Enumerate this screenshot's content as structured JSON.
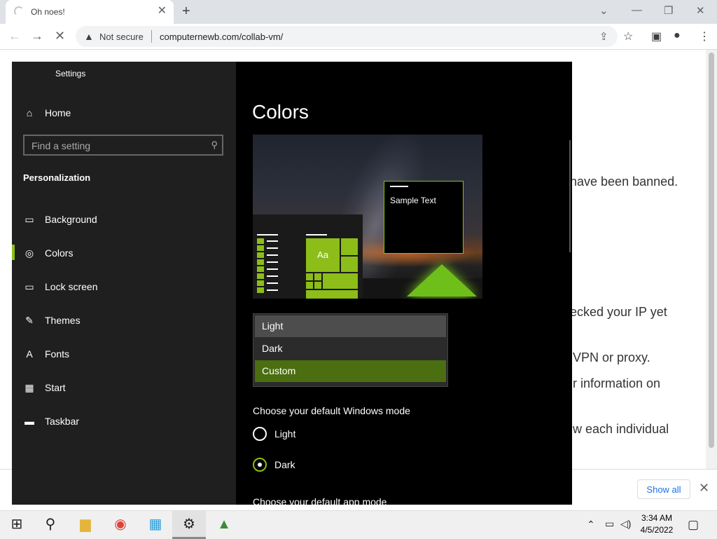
{
  "browser": {
    "tab_title": "Oh noes!",
    "tab_close": "✕",
    "new_tab": "+",
    "window_controls": [
      "⌄",
      "—",
      "❐",
      "✕"
    ],
    "nav": {
      "back": "←",
      "forward": "→",
      "stop": "✕"
    },
    "security_label": "Not secure",
    "url": "computernewb.com/collab-vm/"
  },
  "page_bg": {
    "lines": [
      "have been banned.",
      "ecked your IP yet",
      "VPN or proxy.",
      "r information on",
      "w each individual"
    ]
  },
  "downloads": {
    "show_all": "Show all",
    "close": "✕"
  },
  "settings": {
    "window_title": "Settings",
    "home": "Home",
    "search_placeholder": "Find a setting",
    "section": "Personalization",
    "nav": [
      {
        "label": "Background",
        "icon": "image-icon"
      },
      {
        "label": "Colors",
        "icon": "palette-icon"
      },
      {
        "label": "Lock screen",
        "icon": "lock-screen-icon"
      },
      {
        "label": "Themes",
        "icon": "themes-icon"
      },
      {
        "label": "Fonts",
        "icon": "fonts-icon"
      },
      {
        "label": "Start",
        "icon": "start-icon"
      },
      {
        "label": "Taskbar",
        "icon": "taskbar-icon"
      }
    ],
    "active_item": "Colors",
    "accent_color": "#8cbd18",
    "page_title": "Colors",
    "preview": {
      "tile_label": "Aa",
      "sample_text": "Sample Text"
    },
    "color_options": [
      "Light",
      "Dark",
      "Custom"
    ],
    "selected_color_option": "Custom",
    "windows_mode_label": "Choose your default Windows mode",
    "windows_modes": [
      "Light",
      "Dark"
    ],
    "windows_mode_selected": "Dark",
    "app_mode_label": "Choose your default app mode"
  },
  "taskbar": {
    "clock_time": "3:34 AM",
    "clock_date": "4/5/2022"
  }
}
